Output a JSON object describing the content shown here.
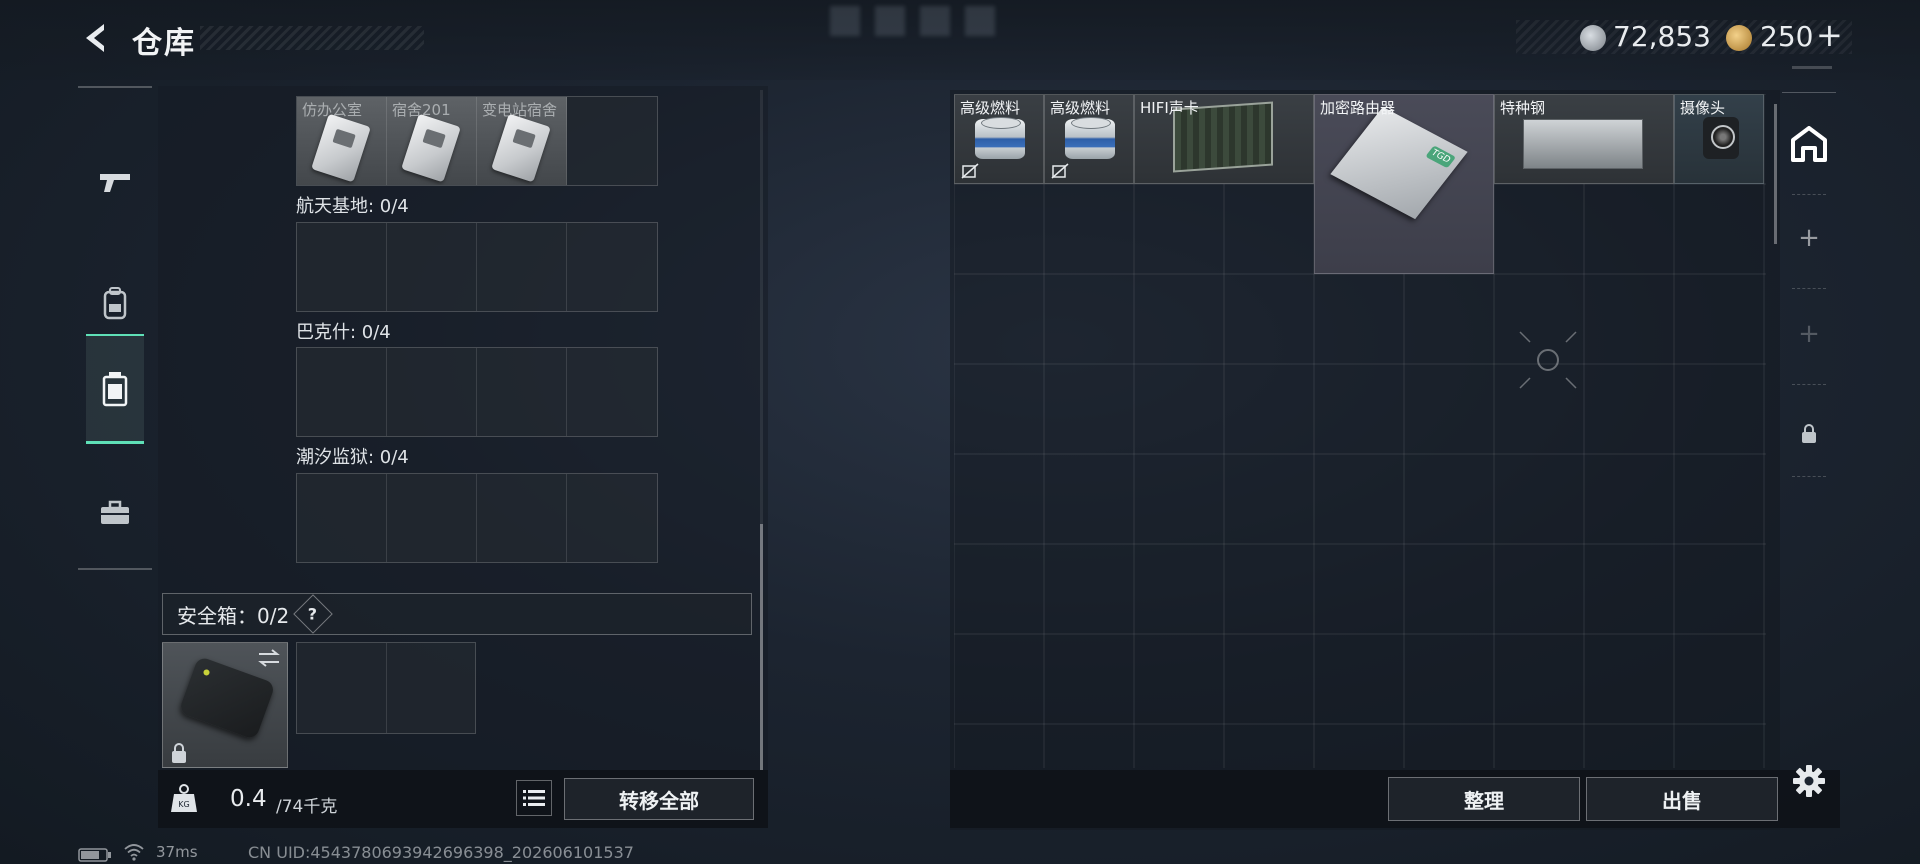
{
  "header": {
    "title": "仓库",
    "currency_1": "72,853",
    "currency_2": "250",
    "add_symbol": "+"
  },
  "left_rail": {
    "tabs": [
      "weapons-icon",
      "equipment-icon",
      "container-icon",
      "toolbox-icon"
    ],
    "active_tab": "container-icon",
    "accent_color": "#5fe0b7"
  },
  "key_rooms": [
    {
      "label": "",
      "slots": [
        "仿办公室",
        "宿舍201",
        "变电站宿舍",
        ""
      ]
    },
    {
      "label": "航天基地: 0/4",
      "slots": [
        "",
        "",
        "",
        ""
      ]
    },
    {
      "label": "巴克什: 0/4",
      "slots": [
        "",
        "",
        "",
        ""
      ]
    },
    {
      "label": "潮汐监狱: 0/4",
      "slots": [
        "",
        "",
        "",
        ""
      ]
    }
  ],
  "safebox": {
    "label": "安全箱：0/2",
    "help": "?"
  },
  "bottom_left": {
    "weight_current": "0.4",
    "weight_max": "/74千克",
    "transfer_all": "转移全部"
  },
  "stash_items": [
    {
      "name": "高级燃料",
      "icon": "fuel-can-icon"
    },
    {
      "name": "高级燃料",
      "icon": "fuel-can-icon"
    },
    {
      "name": "HIFI声卡",
      "icon": "sound-card-icon"
    },
    {
      "name": "加密路由器",
      "icon": "router-icon"
    },
    {
      "name": "特种钢",
      "icon": "steel-icon"
    },
    {
      "name": "摄像头",
      "icon": "camera-icon"
    }
  ],
  "bottom_right": {
    "sort": "整理",
    "sell": "出售"
  },
  "status": {
    "ping": "37ms",
    "uid": "CN UID:4543780693942696398_202606101537"
  }
}
